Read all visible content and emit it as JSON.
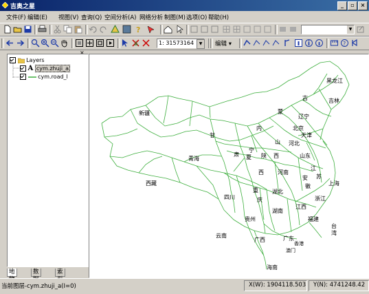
{
  "app": {
    "title": "吉奥之星"
  },
  "window": {
    "minimize": "_",
    "maximize": "▫",
    "close": "×"
  },
  "menu": [
    {
      "label": "文件(F)"
    },
    {
      "label": "编辑(E)"
    },
    {
      "label": "视图(V)"
    },
    {
      "label": "查询(Q)"
    },
    {
      "label": "空间分析(A)"
    },
    {
      "label": "网络分析"
    },
    {
      "label": "制图(M)"
    },
    {
      "label": "选项(O)"
    },
    {
      "label": "帮助(H)"
    }
  ],
  "toolbar": {
    "scale": "1: 31573164",
    "edit_label": "编辑 ▾"
  },
  "toc": {
    "close": "×",
    "root": "Layers",
    "layers": [
      {
        "name": "cym.zhuji_a",
        "symbol": "A",
        "selected": true
      },
      {
        "name": "cym.road_l",
        "symbol": "line",
        "selected": false
      }
    ]
  },
  "tabs": [
    {
      "label": "地物层"
    },
    {
      "label": "数据源"
    },
    {
      "label": "索引图"
    }
  ],
  "map": {
    "labels": [
      {
        "text": "黑龙江"
      },
      {
        "text": "吉林"
      },
      {
        "text": "古"
      },
      {
        "text": "蒙"
      },
      {
        "text": "新疆"
      },
      {
        "text": "辽宁"
      },
      {
        "text": "内"
      },
      {
        "text": "北京"
      },
      {
        "text": "天津"
      },
      {
        "text": "甘"
      },
      {
        "text": "山"
      },
      {
        "text": "河北"
      },
      {
        "text": "宁"
      },
      {
        "text": "青海"
      },
      {
        "text": "肃"
      },
      {
        "text": "夏"
      },
      {
        "text": "陕"
      },
      {
        "text": "西"
      },
      {
        "text": "山东"
      },
      {
        "text": "江"
      },
      {
        "text": "西"
      },
      {
        "text": "河南"
      },
      {
        "text": "苏"
      },
      {
        "text": "安"
      },
      {
        "text": "上海"
      },
      {
        "text": "西藏"
      },
      {
        "text": "重"
      },
      {
        "text": "湖北"
      },
      {
        "text": "徽"
      },
      {
        "text": "四川"
      },
      {
        "text": "庆"
      },
      {
        "text": "浙江"
      },
      {
        "text": "湖南"
      },
      {
        "text": "江西"
      },
      {
        "text": "贵州"
      },
      {
        "text": "福建"
      },
      {
        "text": "云南"
      },
      {
        "text": "广西"
      },
      {
        "text": "广东"
      },
      {
        "text": "台"
      },
      {
        "text": "湾"
      },
      {
        "text": "香港"
      },
      {
        "text": "澳门"
      },
      {
        "text": "海南"
      }
    ]
  },
  "status": {
    "current_layer": "当前图层-cym.zhuji_a(I=0)",
    "x": "X(W): 1904118.503",
    "y": "Y(N): 4741248.42"
  },
  "colors": {
    "road": "#3cae3c",
    "titlebar": "#0a246a"
  }
}
